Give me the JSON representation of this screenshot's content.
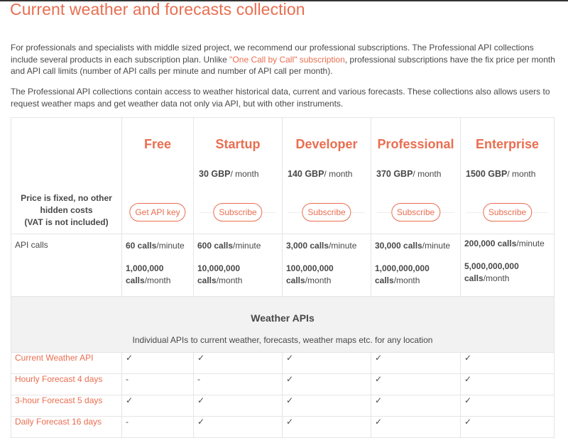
{
  "page_title": "Current weather and forecasts collection",
  "intro": {
    "p1_before": "For professionals and specialists with middle sized project, we recommend our professional subscriptions. The Professional API collections include several products in each subscription plan. Unlike ",
    "p1_link": "\"One Call by Call\" subscription",
    "p1_after": ", professional subscriptions have the fix price per month and API call limits (number of API calls per minute and number of API call per month).",
    "p2": "The Professional API collections contain access to weather historical data, current and various forecasts. These collections also allows users to request weather maps and get weather data not only via API, but with other instruments."
  },
  "pricing_note": [
    "Price is fixed, no other",
    "hidden costs",
    "(VAT is not included)"
  ],
  "plans": [
    {
      "name": "Free",
      "price": "",
      "per": "",
      "button": "Get API key",
      "calls_min": "60 calls",
      "calls_month_num": "1,000,000",
      "calls_month_unit": "calls"
    },
    {
      "name": "Startup",
      "price": "30 GBP",
      "per": "/ month",
      "button": "Subscribe",
      "calls_min": "600 calls",
      "calls_month_num": "10,000,000",
      "calls_month_unit": "calls"
    },
    {
      "name": "Developer",
      "price": "140 GBP",
      "per": "/ month",
      "button": "Subscribe",
      "calls_min": "3,000 calls",
      "calls_month_num": "100,000,000",
      "calls_month_unit": "calls"
    },
    {
      "name": "Professional",
      "price": "370 GBP",
      "per": "/ month",
      "button": "Subscribe",
      "calls_min": "30,000 calls",
      "calls_month_num": "1,000,000,000",
      "calls_month_unit": "calls"
    },
    {
      "name": "Enterprise",
      "price": "1500 GBP",
      "per": "/ month",
      "button": "Subscribe",
      "calls_min": "200,000 calls",
      "calls_month_num": "5,000,000,000",
      "calls_month_unit": "calls"
    }
  ],
  "units": {
    "per_minute": "/minute",
    "per_month": "/month"
  },
  "api_calls_label": "API calls",
  "section": {
    "title": "Weather APIs",
    "subtitle": "Individual APIs to current weather, forecasts, weather maps etc. for any location"
  },
  "features": [
    {
      "name": "Current Weather API",
      "marks": [
        "✓",
        "✓",
        "✓",
        "✓",
        "✓"
      ]
    },
    {
      "name": "Hourly Forecast 4 days",
      "marks": [
        "-",
        "-",
        "✓",
        "✓",
        "✓"
      ]
    },
    {
      "name": "3-hour Forecast 5 days",
      "marks": [
        "✓",
        "✓",
        "✓",
        "✓",
        "✓"
      ]
    },
    {
      "name": "Daily Forecast 16 days",
      "marks": [
        "-",
        "✓",
        "✓",
        "✓",
        "✓"
      ]
    }
  ],
  "colors": {
    "accent": "#e96e50",
    "text": "#48484a",
    "section_bg": "#f2f2f2",
    "border": "#e5e5e5"
  }
}
